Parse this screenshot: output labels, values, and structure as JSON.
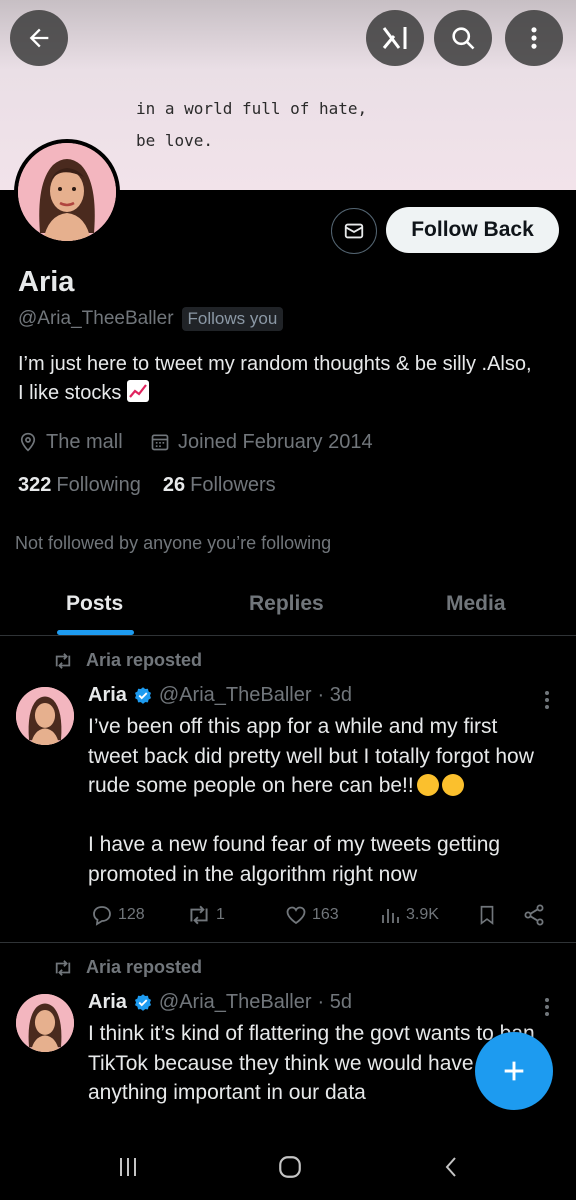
{
  "banner": {
    "quote": "in a world full of hate,\nbe love."
  },
  "topbar": {
    "back_icon": "arrow-left-icon",
    "grok_icon": "grok-icon",
    "search_icon": "search-icon",
    "more_icon": "more-vertical-icon"
  },
  "profile": {
    "name": "Aria",
    "handle": "@Aria_TheeBaller",
    "follows_you": "Follows you",
    "bio": "I’m just here to tweet my random thoughts & be silly .Also, I like stocks",
    "location": "The mall",
    "joined": "Joined February 2014",
    "following_count": "322",
    "following_label": "Following",
    "followers_count": "26",
    "followers_label": "Followers",
    "not_followed": "Not followed by anyone you’re following",
    "follow_button": "Follow Back"
  },
  "tabs": [
    {
      "label": "Posts",
      "active": true
    },
    {
      "label": "Replies",
      "active": false
    },
    {
      "label": "Media",
      "active": false
    }
  ],
  "posts": [
    {
      "repost_label": "Aria reposted",
      "name": "Aria",
      "handle": "@Aria_TheBaller",
      "time": "· 3d",
      "text_1": "I’ve been off this app for a while and my first tweet back did pretty well but I totally forgot how rude some people on here can be!!",
      "text_2": "I have a new found fear of my tweets getting promoted in the algorithm right now",
      "replies": "128",
      "reposts": "1",
      "likes": "163",
      "views": "3.9K"
    },
    {
      "repost_label": "Aria reposted",
      "name": "Aria",
      "handle": "@Aria_TheBaller",
      "time": "· 5d",
      "text_1": "I think it’s kind of flattering the govt wants to ban TikTok because they think we would have anything important in our data"
    }
  ],
  "colors": {
    "accent": "#1d9bf0",
    "background": "#000000",
    "muted": "#71767b"
  }
}
